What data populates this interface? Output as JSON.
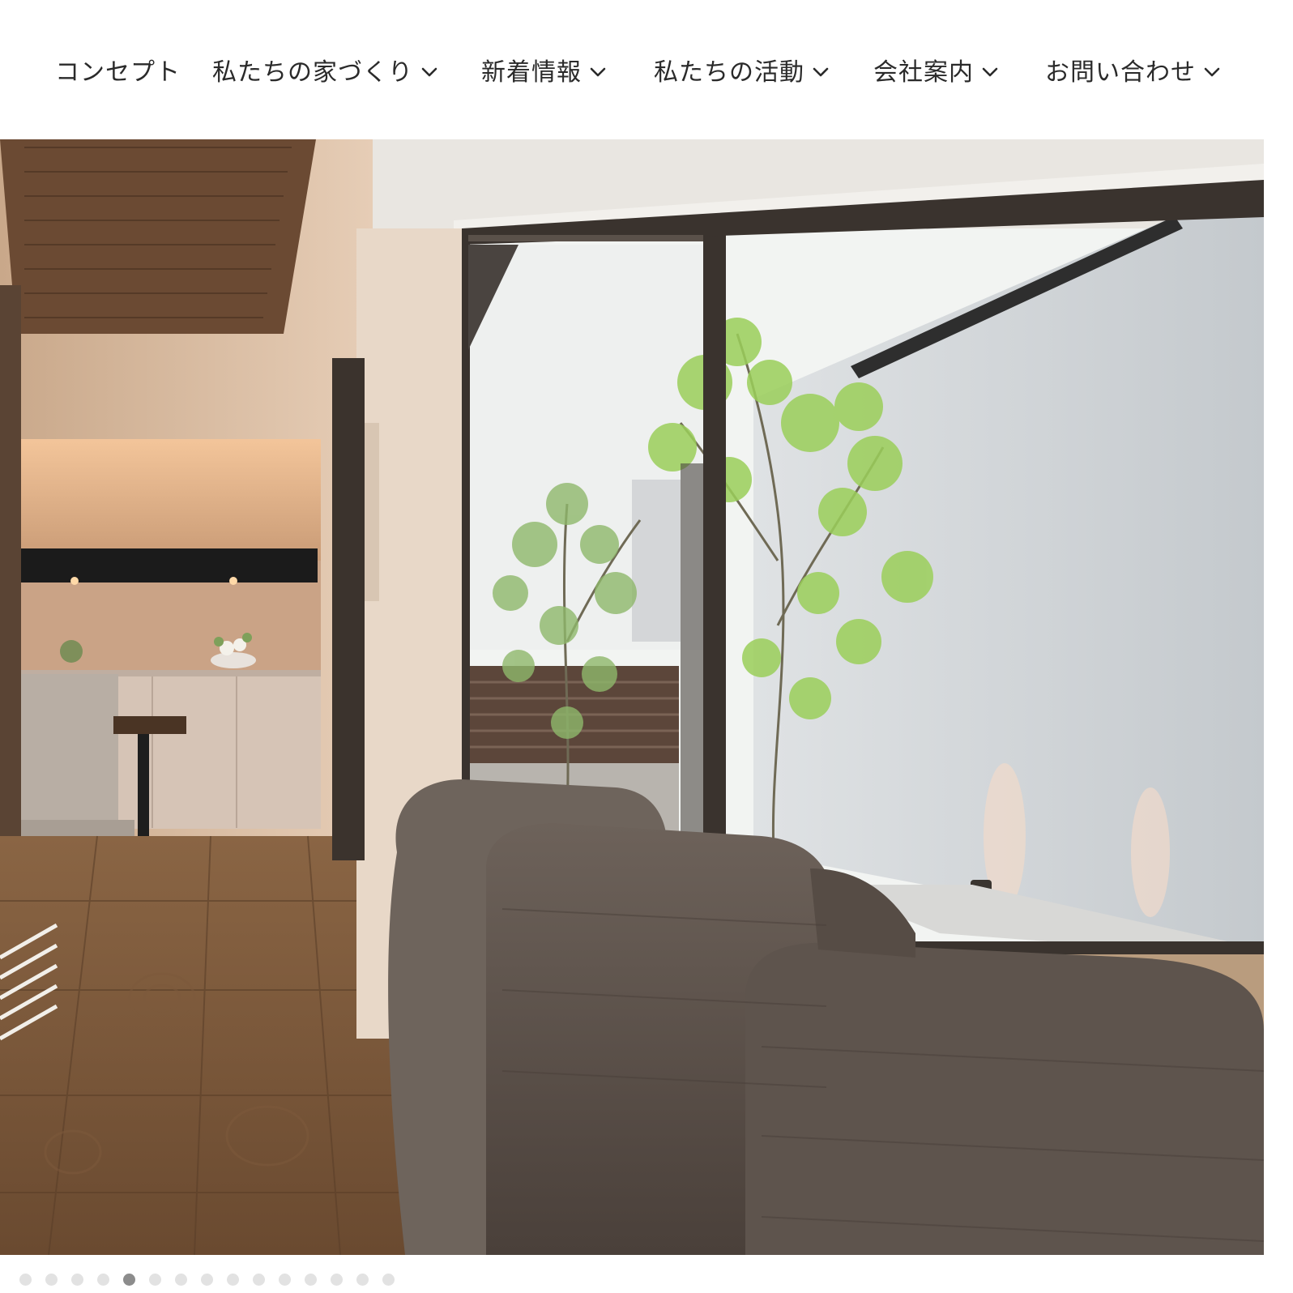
{
  "nav": {
    "items": [
      {
        "label": "コンセプト",
        "has_dropdown": false
      },
      {
        "label": "私たちの家づくり",
        "has_dropdown": true
      },
      {
        "label": "新着情報",
        "has_dropdown": true
      },
      {
        "label": "私たちの活動",
        "has_dropdown": true
      },
      {
        "label": "会社案内",
        "has_dropdown": true
      },
      {
        "label": "お問い合わせ",
        "has_dropdown": true
      }
    ],
    "dropdown_icon": "chevron-down-icon"
  },
  "hero": {
    "image_subject": "living room interior with sofa, wooden floor and glass doors opening to a courtyard with maple trees"
  },
  "carousel": {
    "total_slides": 15,
    "active_slide": 5,
    "colors": {
      "dot": "#e2e2e2",
      "dot_active": "#8c8c8c"
    }
  }
}
